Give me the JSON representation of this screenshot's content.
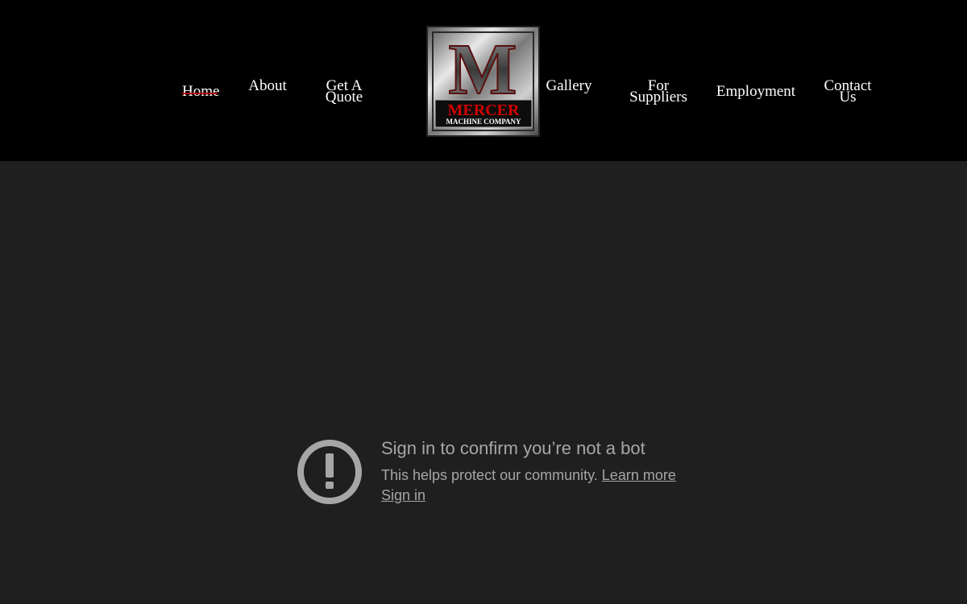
{
  "nav": {
    "home": "Home",
    "about": "About",
    "get_quote": "Get A\nQuote",
    "gallery": "Gallery",
    "for_suppliers": "For\nSuppliers",
    "employment": "Employment",
    "contact_us": "Contact\nUs"
  },
  "logo": {
    "letter": "M",
    "name": "MERCER",
    "tagline": "MACHINE COMPANY"
  },
  "notice": {
    "icon": "alert-circle-icon",
    "title": "Sign in to confirm you’re not a bot",
    "body": "This helps protect our community.",
    "learn_more": "Learn more",
    "sign_in": "Sign in"
  },
  "colors": {
    "header_bg": "#000000",
    "page_bg": "#1f1f1f",
    "accent": "#b30000",
    "muted_text": "#a6a6a6"
  }
}
